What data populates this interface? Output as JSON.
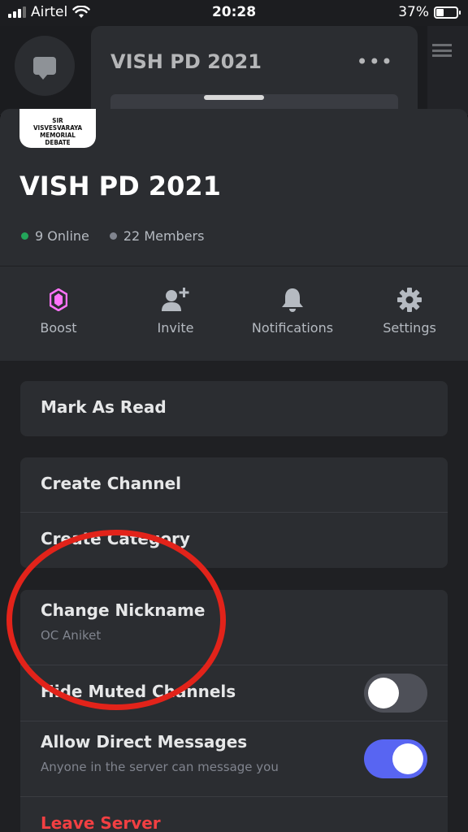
{
  "status_bar": {
    "carrier": "Airtel",
    "time": "20:28",
    "battery": "37%",
    "battery_level": 0.37
  },
  "background": {
    "server_title": "VISH PD 2021",
    "more_icon": "ellipsis-icon",
    "chat_icon": "chat-bubble-icon"
  },
  "server": {
    "icon_lines": [
      "SIR",
      "VISVESVARAYA",
      "MEMORIAL",
      "DEBATE"
    ],
    "name": "VISH PD 2021",
    "online": "9 Online",
    "members": "22 Members",
    "online_color": "#23a55a"
  },
  "actions": [
    {
      "label": "Boost",
      "icon": "boost-gem-icon"
    },
    {
      "label": "Invite",
      "icon": "add-user-icon"
    },
    {
      "label": "Notifications",
      "icon": "bell-icon"
    },
    {
      "label": "Settings",
      "icon": "gear-icon"
    }
  ],
  "menu": {
    "mark_as_read": "Mark As Read",
    "create_channel": "Create Channel",
    "create_category": "Create Category",
    "change_nickname": "Change Nickname",
    "nickname": "OC Aniket",
    "hide_muted_channels": "Hide Muted Channels",
    "hide_muted_enabled": false,
    "allow_dms": "Allow Direct Messages",
    "allow_dms_desc": "Anyone in the server can message you",
    "allow_dms_enabled": true,
    "leave_server": "Leave Server"
  },
  "colors": {
    "accent": "#5865f2",
    "danger": "#f23f42",
    "boost": "#ff73fa",
    "annotation": "#e2231a"
  }
}
